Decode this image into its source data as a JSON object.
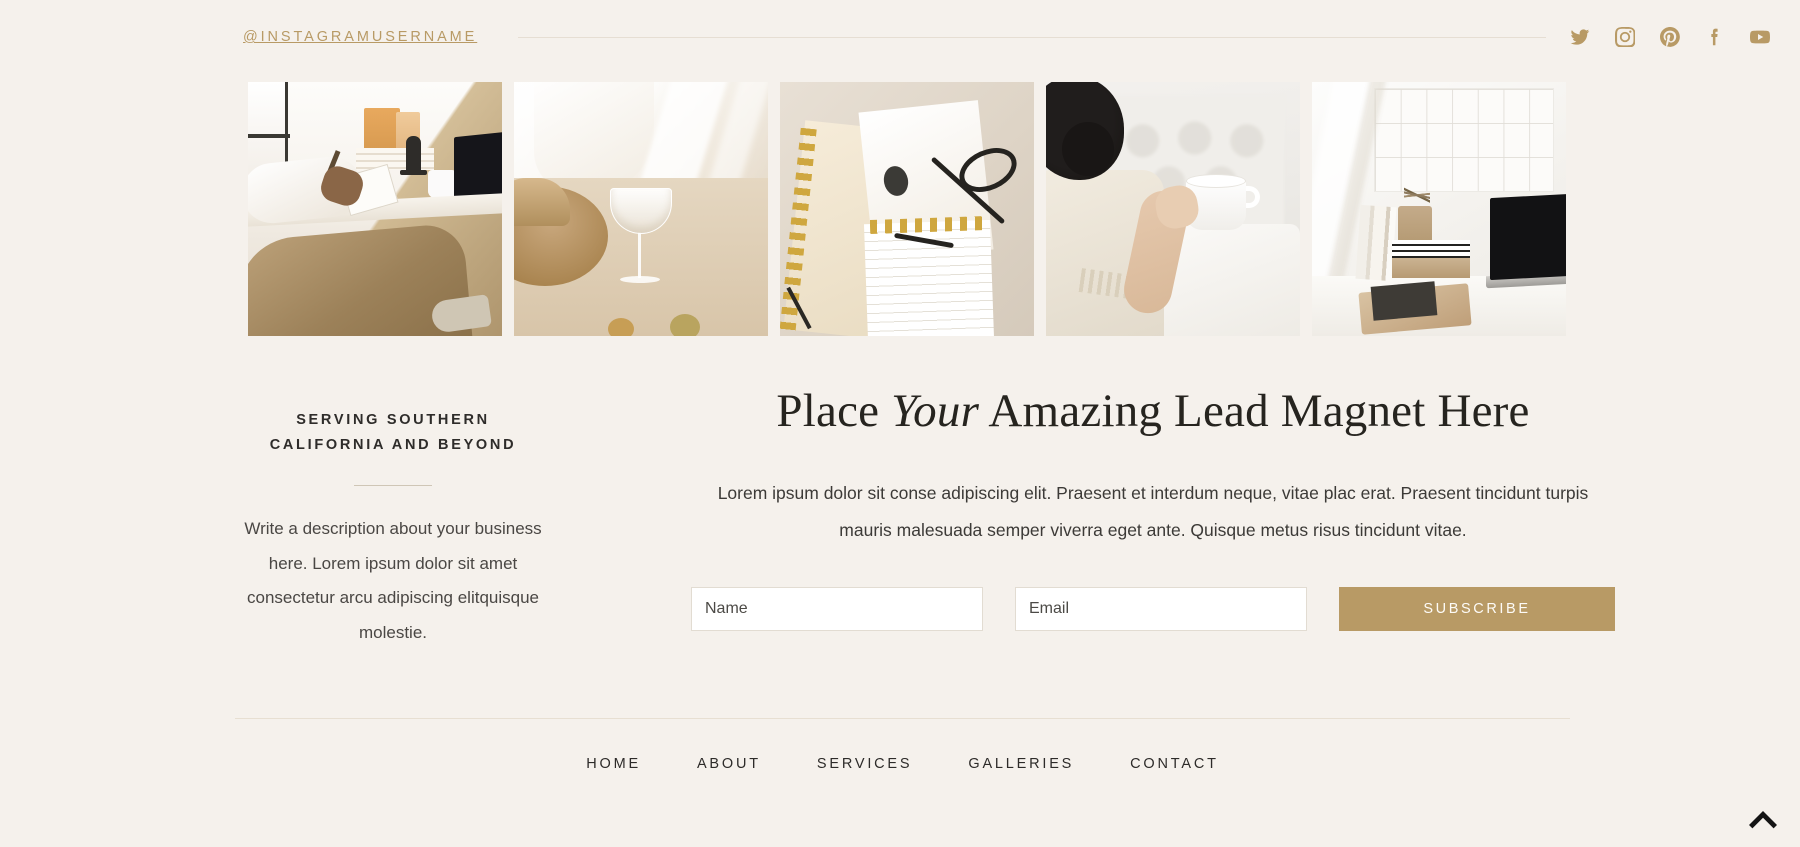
{
  "theme": {
    "background": "#f5f1ec",
    "accent_gold": "#b89a65",
    "text_dark": "#2c2c2c",
    "rule": "#e7dfd2"
  },
  "instagram_bar": {
    "handle": "@INSTAGRAMUSERNAME",
    "socials": [
      {
        "name": "twitter",
        "label": "Twitter"
      },
      {
        "name": "instagram",
        "label": "Instagram"
      },
      {
        "name": "pinterest",
        "label": "Pinterest"
      },
      {
        "name": "facebook",
        "label": "Facebook"
      },
      {
        "name": "youtube",
        "label": "YouTube"
      }
    ]
  },
  "gallery": {
    "items": [
      {
        "alt": "Person writing in notebook at a sunlit white desk with laptop"
      },
      {
        "alt": "Straw hat and coupe glass on a table in bright sunlight"
      },
      {
        "alt": "Gold spiral notebooks with black eyeglasses on a beige surface"
      },
      {
        "alt": "Woman with dark curly hair holding a white mug on a tufted bed"
      },
      {
        "alt": "Minimal white desk with wall calendar, pencil cup, books and laptop"
      }
    ]
  },
  "left_column": {
    "eyebrow": "SERVING SOUTHERN CALIFORNIA AND BEYOND",
    "description": "Write a description about your business here. Lorem ipsum dolor sit amet consectetur arcu adipiscing elitquisque molestie."
  },
  "lead_magnet": {
    "headline_part1": "Place ",
    "headline_emphasis": "Your",
    "headline_part2": " Amazing Lead Magnet Here",
    "body": "Lorem ipsum dolor sit conse adipiscing elit. Praesent et interdum neque, vitae plac erat. Praesent tincidunt turpis mauris malesuada semper viverra eget ante. Quisque metus risus tincidunt vitae.",
    "form": {
      "name_placeholder": "Name",
      "name_value": "",
      "email_placeholder": "Email",
      "email_value": "",
      "submit_label": "SUBSCRIBE"
    }
  },
  "footer": {
    "nav": [
      {
        "label": "HOME"
      },
      {
        "label": "ABOUT"
      },
      {
        "label": "SERVICES"
      },
      {
        "label": "GALLERIES"
      },
      {
        "label": "CONTACT"
      }
    ],
    "back_to_top_label": "Back to top"
  }
}
